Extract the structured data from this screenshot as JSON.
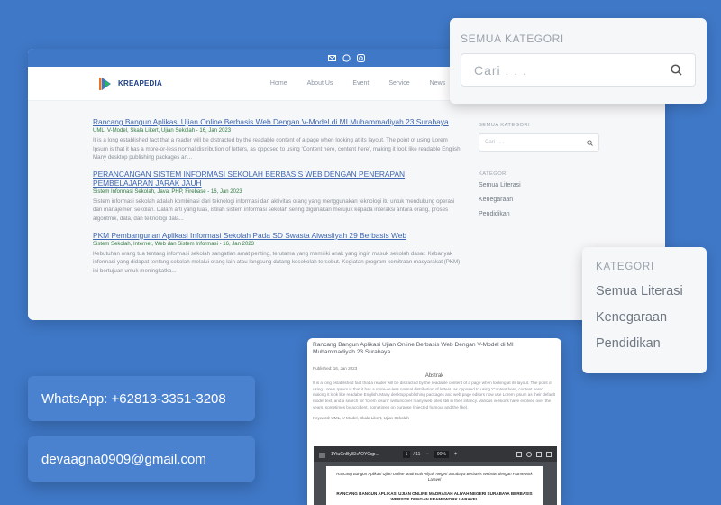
{
  "site": {
    "logo_text": "KREAPEDIA",
    "nav": [
      "Home",
      "About Us",
      "Event",
      "Service",
      "News"
    ],
    "posts": [
      {
        "title": "Rancang Bangun Aplikasi Ujian Online Berbasis Web Dengan V-Model di MI Muhammadiyah 23 Surabaya",
        "meta": "UML, V-Model, Skala Likert, Ujian Sekolah - 16, Jan 2023",
        "excerpt": "It is a long established fact that a reader will be distracted by the readable content of a page when looking at its layout. The point of using Lorem Ipsum is that it has a more-or-less normal distribution of letters, as opposed to using 'Content here, content here', making it look like readable English. Many desktop publishing packages an..."
      },
      {
        "title": "PERANCANGAN SISTEM INFORMASI SEKOLAH BERBASIS WEB DENGAN PENERAPAN PEMBELAJARAN JARAK JAUH",
        "meta": "Sistem Informasi Sekolah, Java, PHP, Firebase - 16, Jan 2023",
        "excerpt": "Sistem informasi sekolah adalah kombinasi dari teknologi informasi dan aktivitas orang yang menggunakan teknologi itu untuk mendukung operasi dan manajemen sekolah. Dalam arti yang luas, istilah sistem informasi sekolah sering digunakan merujuk kepada interaksi antara orang, proses algoritmik, data, dan teknologi dala..."
      },
      {
        "title": "PKM Pembangunan Aplikasi Informasi Sekolah Pada SD Swasta Alwasliyah 29 Berbasis Web",
        "meta": "Sistem Sekolah, Internet, Web dan Sistem Informasi - 16, Jan 2023",
        "excerpt": "Kebutuhan orang tua tentang informasi sekolah sangatlah amat penting, terutama yang memiliki anak yang ingin masuk sekolah dasar. Kebanyak informasi yang didapat tentang sekolah melalui orang lain atau langsung datang kesekolah tersebut. Kegiatan program kemitraan masyarakat (PKM) ini bertujuan untuk meningkatka..."
      }
    ],
    "sidebar": {
      "search_heading": "SEMUA KATEGORI",
      "search_placeholder": "Cari . . .",
      "category_heading": "KATEGORI",
      "categories": [
        "Semua Literasi",
        "Kenegaraan",
        "Pendidikan"
      ]
    }
  },
  "zoom_search": {
    "heading": "SEMUA KATEGORI",
    "placeholder": "Cari . . ."
  },
  "zoom_categories": {
    "heading": "KATEGORI",
    "items": [
      "Semua Literasi",
      "Kenegaraan",
      "Pendidikan"
    ]
  },
  "contacts": {
    "whatsapp": "WhatsApp: +62813-3351-3208",
    "email": "devaagna0909@gmail.com"
  },
  "article": {
    "title": "Rancang Bangun Aplikasi Ujian Online Berbasis Web Dengan V-Model di MI Muhammadiyah 23 Surabaya",
    "date": "Published: 16, Jan 2023",
    "abstract_heading": "Abstrak",
    "abstract": "It is a long established fact that a reader will be distracted by the readable content of a page when looking at its layout. The point of using Lorem Ipsum is that it has a more-or-less normal distribution of letters, as opposed to using 'Content here, content here', making it look like readable English. Many desktop publishing packages and web page editors now use Lorem Ipsum as their default model text, and a search for 'lorem ipsum' will uncover many web sites still in their infancy. Various versions have evolved over the years, sometimes by accident, sometimes on purpose (injected humour and the like).",
    "keywords": "Keyword: UML, V-Model, Skala Likert, Ujian Sekolah",
    "pdf": {
      "filename": "1YtuGnBylSkAOYCqp...",
      "page": "1",
      "pages": "/ 11",
      "zoom": "90%",
      "page_line1": "Rancang Bangun Aplikasi Ujian Online Madrasah Aliyah Negeri Surabaya Berbasis Website dengan Framework Laravel",
      "page_line2": "RANCANG BANGUN APLIKASI UJIAN ONLINE MADRASAH ALIYAH NEGERI SURABAYA BERBASIS WEBSITE DENGAN FRAMEWORK LARAVEL"
    }
  },
  "colors": {
    "background": "#3f78c7",
    "link": "#3c66b2",
    "meta_green": "#2f7a3f",
    "contact_card": "#4a82d0"
  }
}
